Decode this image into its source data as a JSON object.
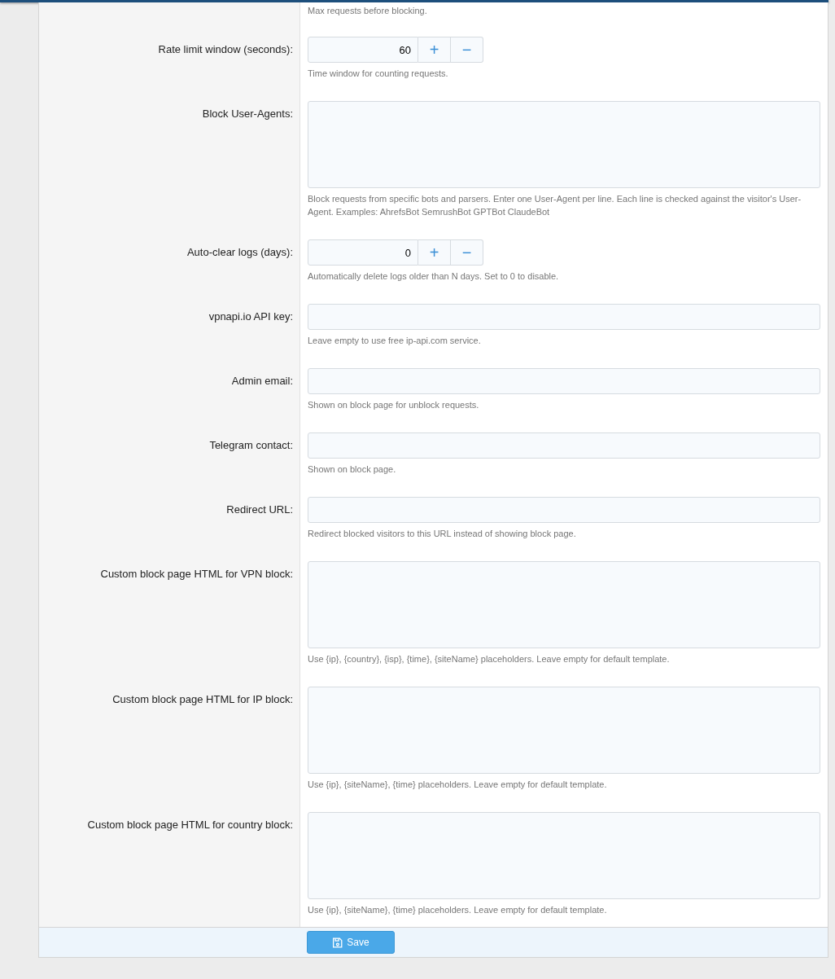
{
  "rows": [
    {
      "kind": "cut",
      "hint": "Max requests before blocking."
    },
    {
      "kind": "number",
      "label": "Rate limit window (seconds):",
      "value": "60",
      "plus": "+",
      "minus": "−",
      "hint": "Time window for counting requests."
    },
    {
      "kind": "textarea",
      "label": "Block User-Agents:",
      "value": "",
      "hint": "Block requests from specific bots and parsers. Enter one User-Agent per line. Each line is checked against the visitor's User-Agent. Examples: AhrefsBot SemrushBot GPTBot ClaudeBot"
    },
    {
      "kind": "number",
      "label": "Auto-clear logs (days):",
      "value": "0",
      "plus": "+",
      "minus": "−",
      "hint": "Automatically delete logs older than N days. Set to 0 to disable."
    },
    {
      "kind": "text",
      "label": "vpnapi.io API key:",
      "value": "",
      "hint": "Leave empty to use free ip-api.com service."
    },
    {
      "kind": "text",
      "label": "Admin email:",
      "value": "",
      "hint": "Shown on block page for unblock requests."
    },
    {
      "kind": "text",
      "label": "Telegram contact:",
      "value": "",
      "hint": "Shown on block page."
    },
    {
      "kind": "text",
      "label": "Redirect URL:",
      "value": "",
      "hint": "Redirect blocked visitors to this URL instead of showing block page."
    },
    {
      "kind": "textarea",
      "label": "Custom block page HTML for VPN block:",
      "value": "",
      "hint": "Use {ip}, {country}, {isp}, {time}, {siteName} placeholders. Leave empty for default template."
    },
    {
      "kind": "textarea",
      "label": "Custom block page HTML for IP block:",
      "value": "",
      "hint": "Use {ip}, {siteName}, {time} placeholders. Leave empty for default template."
    },
    {
      "kind": "textarea",
      "label": "Custom block page HTML for country block:",
      "value": "",
      "hint": "Use {ip}, {siteName}, {time} placeholders. Leave empty for default template."
    }
  ],
  "save_button": {
    "label": "Save"
  }
}
